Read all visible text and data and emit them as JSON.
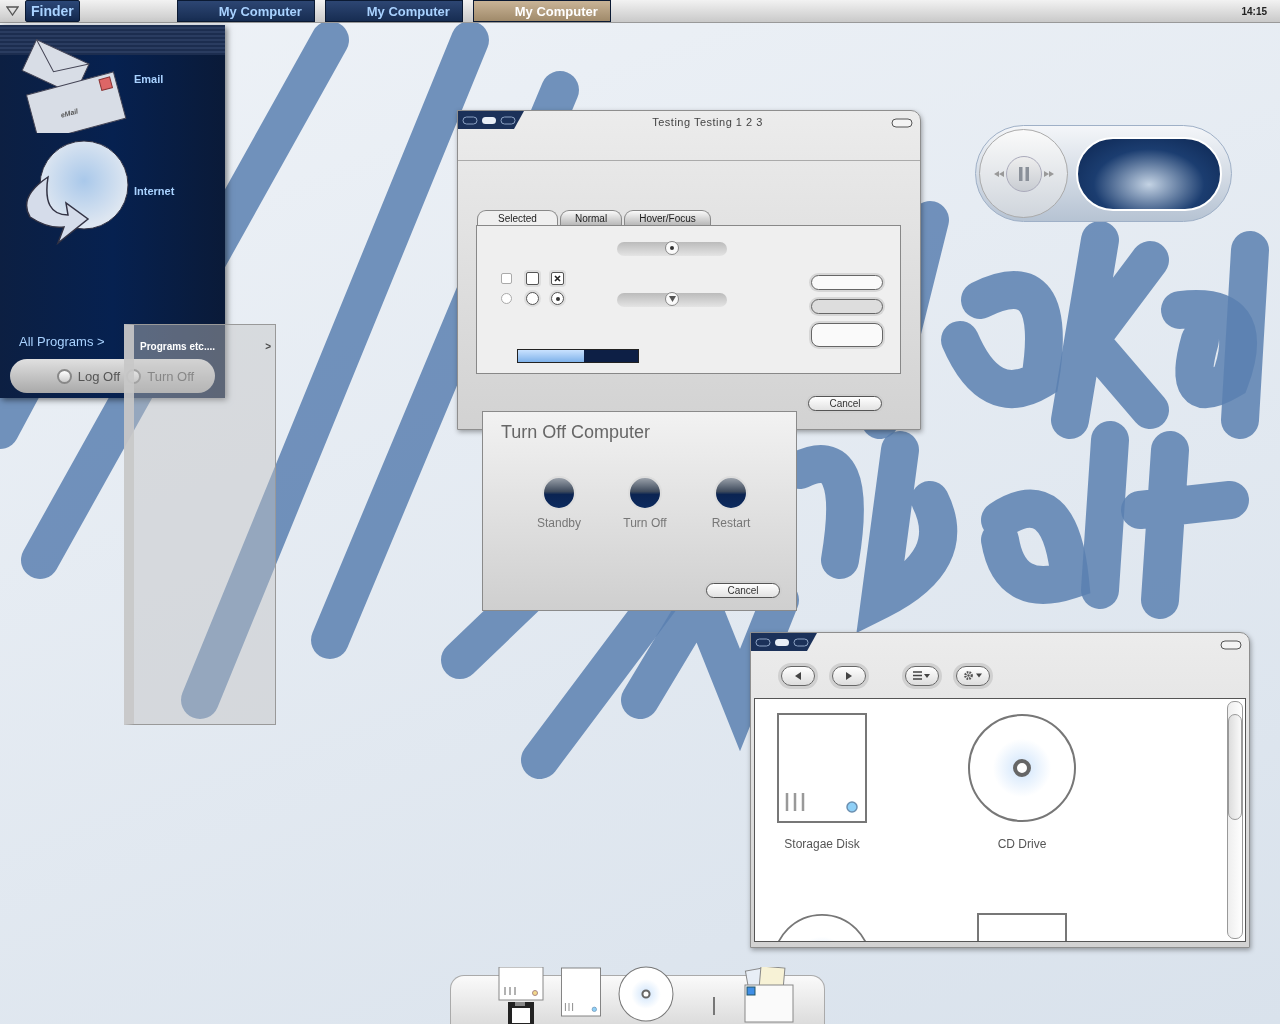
{
  "taskbar": {
    "start_button": "Finder",
    "tasks": [
      {
        "label": "My Computer",
        "selected": false
      },
      {
        "label": "My Computer",
        "selected": false
      },
      {
        "label": "My Computer",
        "selected": true
      }
    ],
    "clock": "14:15"
  },
  "start_menu": {
    "items": [
      {
        "kind": "email",
        "label": "Email",
        "icon_text": "eMail"
      },
      {
        "kind": "internet",
        "label": "Internet"
      }
    ],
    "all_programs": "All Programs >",
    "buttons": [
      "Log Off",
      "Turn Off"
    ]
  },
  "submenu": {
    "items": [
      {
        "label": "Programs etc....",
        "arrow": ">"
      }
    ]
  },
  "test_window": {
    "title": "Testing Testing 1 2 3",
    "tabs": [
      {
        "label": "Selected",
        "selected": true
      },
      {
        "label": "Normal",
        "selected": false
      },
      {
        "label": "Hover/Focus",
        "selected": false
      }
    ],
    "checkboxes": [
      {
        "kind": "flat",
        "checked": false
      },
      {
        "kind": "raised",
        "checked": false
      },
      {
        "kind": "raised",
        "checked": true
      }
    ],
    "radios": [
      {
        "kind": "flat",
        "selected": false
      },
      {
        "kind": "raised",
        "selected": false
      },
      {
        "kind": "raised",
        "selected": true
      }
    ],
    "sliders": [
      {
        "kind": "round",
        "level": 0.5
      },
      {
        "kind": "pointer",
        "level": 0.5
      }
    ],
    "progress": {
      "level": 0.55
    },
    "cancel": "Cancel"
  },
  "turn_off_dialog": {
    "title": "Turn Off Computer",
    "options": [
      "Standby",
      "Turn Off",
      "Restart"
    ],
    "cancel": "Cancel"
  },
  "file_window": {
    "items": [
      {
        "kind": "disk",
        "label": "Storagae Disk"
      },
      {
        "kind": "cd",
        "label": "CD Drive"
      },
      {
        "kind": "cd"
      },
      {
        "kind": "disk"
      }
    ]
  },
  "dock": {
    "items": [
      {
        "kind": "floppy"
      },
      {
        "kind": "disk"
      },
      {
        "kind": "cd"
      },
      {
        "kind": "separator"
      },
      {
        "kind": "folder"
      }
    ]
  }
}
